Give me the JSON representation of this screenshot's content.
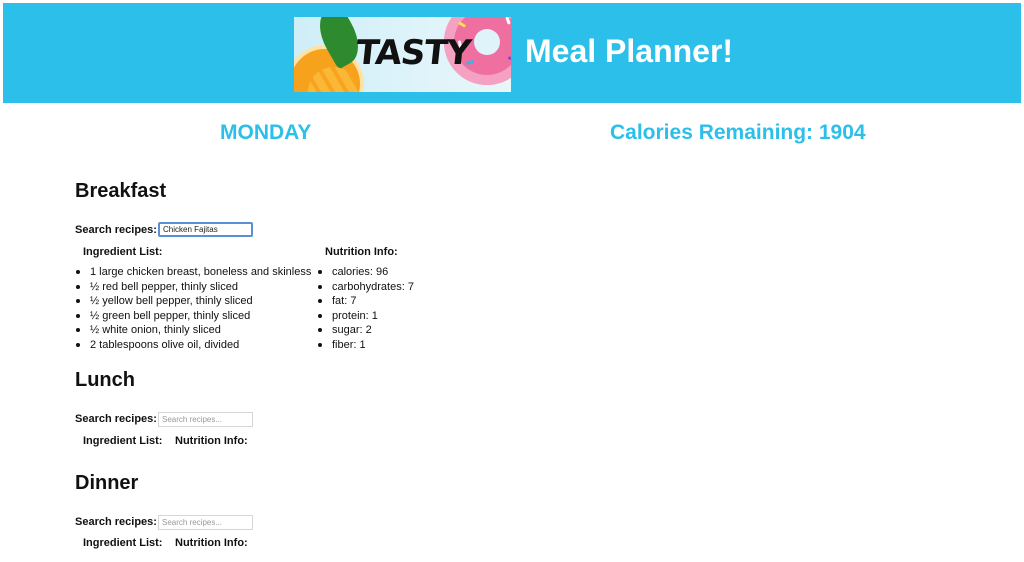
{
  "header": {
    "logo_text": "TASTY",
    "title": "Meal Planner!",
    "background_color": "#2bbfe9"
  },
  "day": "MONDAY",
  "calories_remaining": "Calories Remaining: 1904",
  "meals": {
    "breakfast": {
      "title": "Breakfast",
      "search_label": "Search recipes:",
      "search_value": "Chicken Fajitas",
      "ingredients_label": "Ingredient List:",
      "nutrition_label": "Nutrition Info:",
      "ingredients": [
        "1 large chicken breast, boneless and skinless",
        "½ red bell pepper, thinly sliced",
        "½ yellow bell pepper, thinly sliced",
        "½ green bell pepper, thinly sliced",
        "½ white onion, thinly sliced",
        "2 tablespoons olive oil, divided"
      ],
      "nutrition": [
        "calories: 96",
        "carbohydrates: 7",
        "fat: 7",
        "protein: 1",
        "sugar: 2",
        "fiber: 1"
      ]
    },
    "lunch": {
      "title": "Lunch",
      "search_label": "Search recipes:",
      "search_placeholder": "Search recipes...",
      "ingredients_label": "Ingredient List:",
      "nutrition_label": "Nutrition Info:"
    },
    "dinner": {
      "title": "Dinner",
      "search_label": "Search recipes:",
      "search_placeholder": "Search recipes...",
      "ingredients_label": "Ingredient List:",
      "nutrition_label": "Nutrition Info:"
    }
  }
}
